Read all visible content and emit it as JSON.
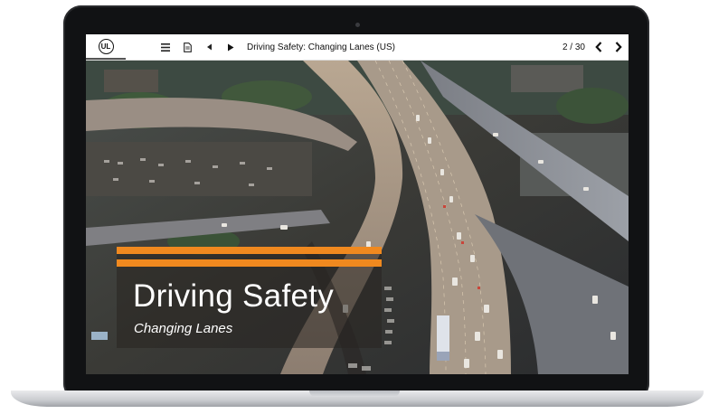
{
  "toolbar": {
    "logo_text": "UL",
    "course_title": "Driving Safety: Changing Lanes (US)",
    "page_indicator": "2 / 30",
    "icons": {
      "menu": "menu-icon",
      "document": "document-icon",
      "rewind": "rewind-icon",
      "play": "play-icon",
      "prev": "chevron-left-icon",
      "next": "chevron-right-icon"
    }
  },
  "hero": {
    "title": "Driving Safety",
    "subtitle": "Changing Lanes"
  },
  "colors": {
    "accent_orange": "#f0891f",
    "toolbar_bg": "#ffffff",
    "laptop_bezel": "#111214"
  }
}
